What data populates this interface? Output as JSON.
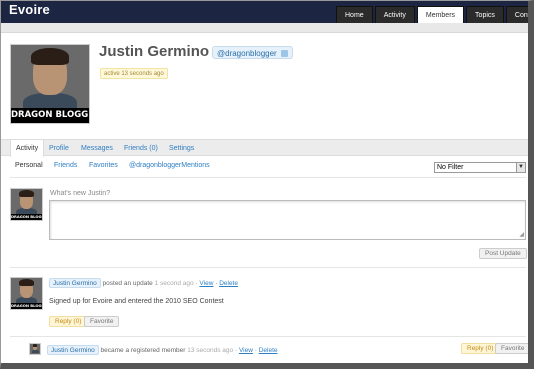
{
  "site": {
    "title": "Evoire"
  },
  "nav": {
    "tabs": [
      "Home",
      "Activity",
      "Members",
      "Topics",
      "Content P"
    ]
  },
  "profile": {
    "name": "Justin Germino",
    "handle": "@dragonblogger",
    "active": "active 13 seconds ago",
    "avatar_brand": "DRAGON BLOGGER"
  },
  "object_nav": {
    "tabs": [
      "Activity",
      "Profile",
      "Messages",
      "Friends (0)",
      "Settings"
    ]
  },
  "sub_nav": {
    "tabs": [
      "Personal",
      "Friends",
      "Favorites",
      "@dragonbloggerMentions"
    ]
  },
  "filter": {
    "selected": "No Filter"
  },
  "post_form": {
    "prompt": "What's new Justin?",
    "submit_label": "Post Update"
  },
  "activity_1": {
    "user": "Justin Germino",
    "action": "posted an update",
    "time": "1 second ago",
    "view": "View",
    "delete": "Delete",
    "content": "Signed up for Evoire and entered the 2010 SEO Contest",
    "reply": "Reply (0)",
    "favorite": "Favorite"
  },
  "activity_2": {
    "user": "Justin Germino",
    "action": "became a registered member",
    "time": "13 seconds ago",
    "view": "View",
    "delete": "Delete",
    "reply": "Reply (0)",
    "favorite": "Favorite"
  },
  "colors": {
    "header": "#1c2642",
    "link": "#2e7ec3",
    "reply": "#c28a12"
  }
}
